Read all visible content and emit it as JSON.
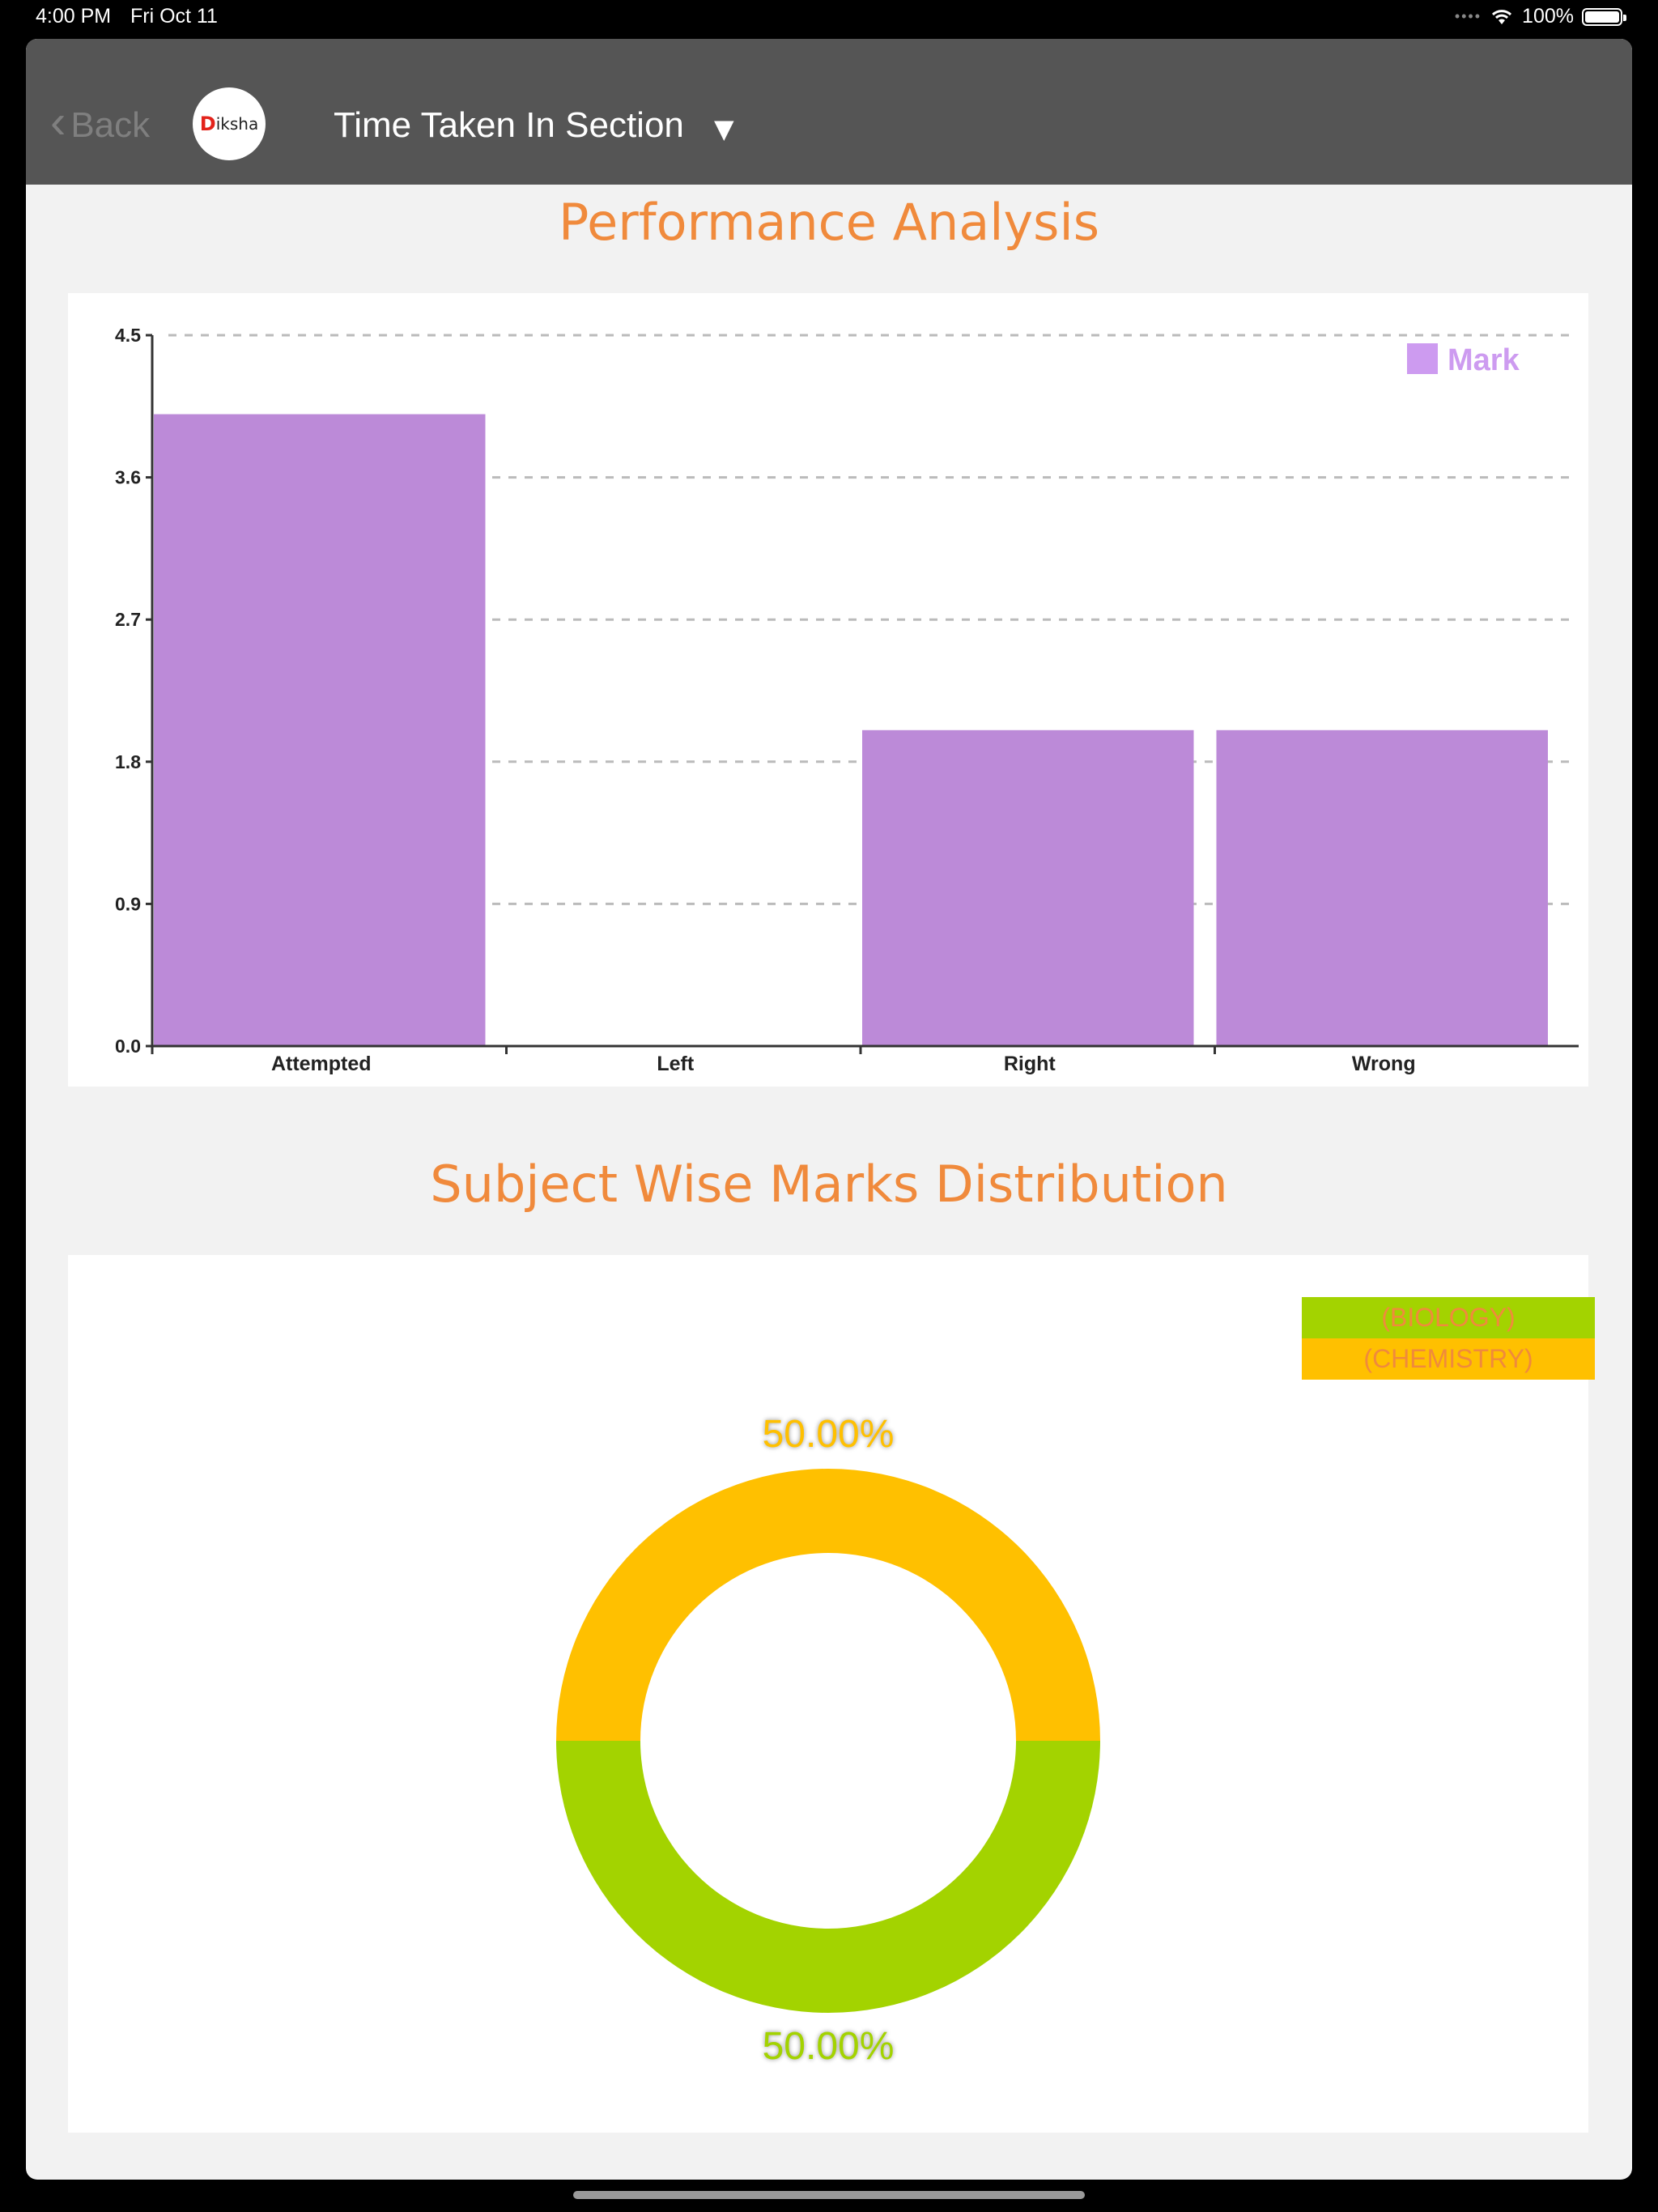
{
  "status": {
    "time": "4:00 PM",
    "date": "Fri Oct 11",
    "battery": "100%"
  },
  "nav": {
    "back_label": "Back",
    "logo_text": "iksha",
    "logo_letter": "D",
    "title": "Time Taken In Section"
  },
  "sections": {
    "performance_title": "Performance Analysis",
    "subject_title": "Subject Wise Marks Distribution"
  },
  "chart_data": [
    {
      "type": "bar",
      "categories": [
        "Attempted",
        "Left",
        "Right",
        "Wrong"
      ],
      "series": [
        {
          "name": "Mark",
          "values": [
            4,
            0,
            2,
            2
          ]
        }
      ],
      "y_ticks": [
        "0.0",
        "0.9",
        "1.8",
        "2.7",
        "3.6",
        "4.5"
      ],
      "ylim": [
        0,
        4.5
      ],
      "grid": true,
      "legend": "top-right",
      "bar_color": "#bc8ad8",
      "legend_color": "#cd9bf0"
    },
    {
      "type": "pie",
      "labels": [
        "(BIOLOGY)",
        "(CHEMISTRY)"
      ],
      "values": [
        50,
        50
      ],
      "value_labels": [
        "50.00%",
        "50.00%"
      ],
      "colors": [
        "#a3d300",
        "#ffc000"
      ],
      "legend": "top-right",
      "donut": true
    }
  ]
}
